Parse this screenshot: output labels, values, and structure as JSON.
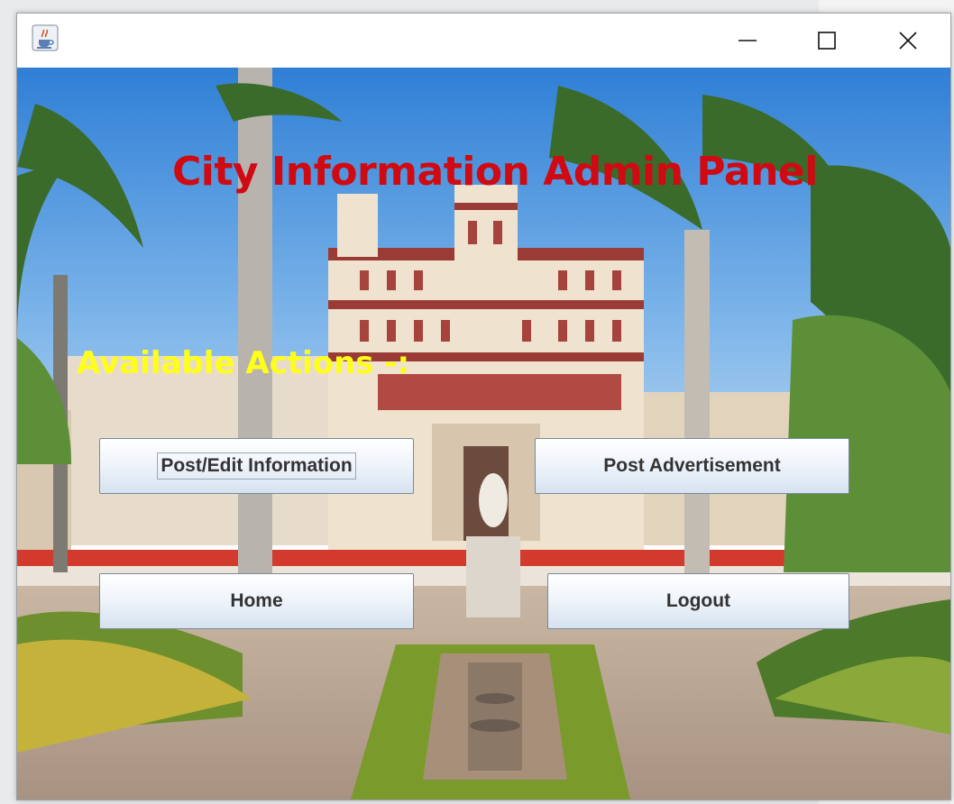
{
  "window": {
    "app_icon": "java-coffee-cup-icon",
    "controls": [
      "minimize-icon",
      "maximize-icon",
      "close-icon"
    ]
  },
  "panel": {
    "title": "City Information Admin Panel",
    "actions_label": "Available Actions -:",
    "title_color": "#cf0a12",
    "label_color": "#ffff1a"
  },
  "buttons": {
    "post_edit_info": "Post/Edit Information",
    "post_advertisement": "Post Advertisement",
    "home": "Home",
    "logout": "Logout"
  }
}
